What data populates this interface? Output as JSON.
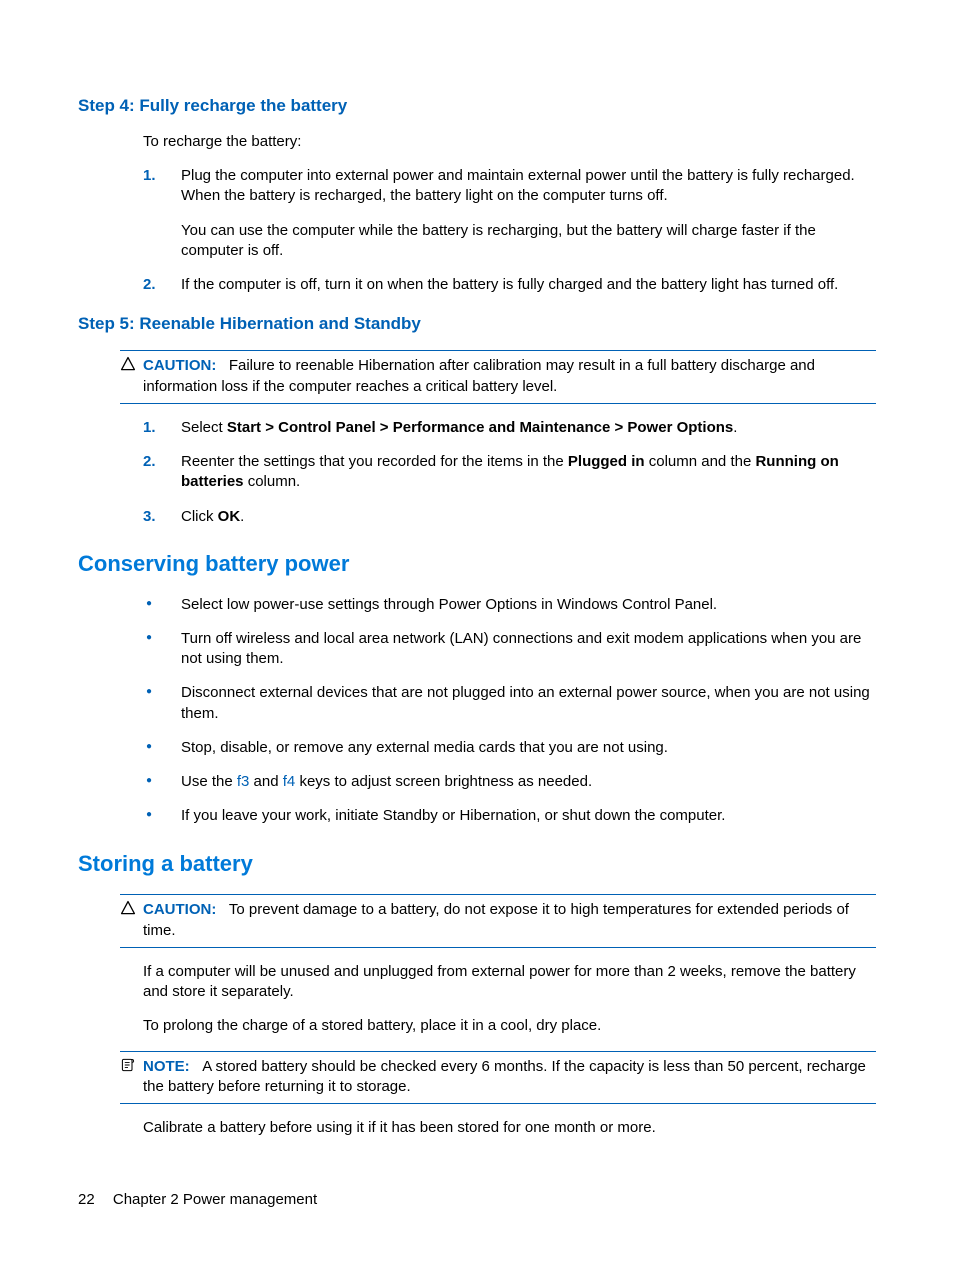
{
  "step4": {
    "heading": "Step 4: Fully recharge the battery",
    "intro": "To recharge the battery:",
    "items": [
      {
        "num": "1.",
        "p1": "Plug the computer into external power and maintain external power until the battery is fully recharged. When the battery is recharged, the battery light on the computer turns off.",
        "p2": "You can use the computer while the battery is recharging, but the battery will charge faster if the computer is off."
      },
      {
        "num": "2.",
        "p1": "If the computer is off, turn it on when the battery is fully charged and the battery light has turned off."
      }
    ]
  },
  "step5": {
    "heading": "Step 5: Reenable Hibernation and Standby",
    "caution": {
      "label": "CAUTION:",
      "text": "Failure to reenable Hibernation after calibration may result in a full battery discharge and information loss if the computer reaches a critical battery level."
    },
    "items": [
      {
        "num": "1.",
        "pre": "Select ",
        "bold": "Start > Control Panel > Performance and Maintenance > Power Options",
        "post": "."
      },
      {
        "num": "2.",
        "pre": "Reenter the settings that you recorded for the items in the ",
        "bold1": "Plugged in",
        "mid": " column and the ",
        "bold2": "Running on batteries",
        "post": " column."
      },
      {
        "num": "3.",
        "pre": "Click ",
        "bold": "OK",
        "post": "."
      }
    ]
  },
  "conserving": {
    "heading": "Conserving battery power",
    "bullets": [
      "Select low power-use settings through Power Options in Windows Control Panel.",
      "Turn off wireless and local area network (LAN) connections and exit modem applications when you are not using them.",
      "Disconnect external devices that are not plugged into an external power source, when you are not using them.",
      "Stop, disable, or remove any external media cards that you are not using."
    ],
    "bullet_keys": {
      "pre": "Use the ",
      "k1": "f3",
      "mid": " and ",
      "k2": "f4",
      "post": " keys to adjust screen brightness as needed."
    },
    "bullet_last": "If you leave your work, initiate Standby or Hibernation, or shut down the computer."
  },
  "storing": {
    "heading": "Storing a battery",
    "caution": {
      "label": "CAUTION:",
      "text": "To prevent damage to a battery, do not expose it to high temperatures for extended periods of time."
    },
    "p1": "If a computer will be unused and unplugged from external power for more than 2 weeks, remove the battery and store it separately.",
    "p2": "To prolong the charge of a stored battery, place it in a cool, dry place.",
    "note": {
      "label": "NOTE:",
      "text": "A stored battery should be checked every 6 months. If the capacity is less than 50 percent, recharge the battery before returning it to storage."
    },
    "p3": "Calibrate a battery before using it if it has been stored for one month or more."
  },
  "footer": {
    "page": "22",
    "chapter": "Chapter 2   Power management"
  }
}
